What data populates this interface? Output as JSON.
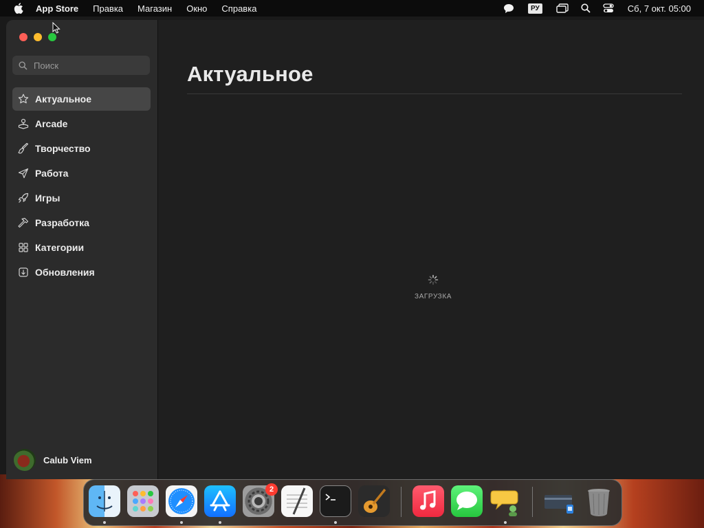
{
  "menubar": {
    "app_name": "App Store",
    "menus": [
      "Правка",
      "Магазин",
      "Окно",
      "Справка"
    ],
    "input_language": "РУ",
    "datetime": "Сб, 7 окт.  05:00"
  },
  "sidebar": {
    "search_placeholder": "Поиск",
    "items": [
      {
        "label": "Актуальное",
        "icon": "star-icon",
        "active": true
      },
      {
        "label": "Arcade",
        "icon": "joystick-icon"
      },
      {
        "label": "Творчество",
        "icon": "brush-icon"
      },
      {
        "label": "Работа",
        "icon": "paper-plane-icon"
      },
      {
        "label": "Игры",
        "icon": "rocket-icon"
      },
      {
        "label": "Разработка",
        "icon": "hammer-icon"
      },
      {
        "label": "Категории",
        "icon": "grid-icon"
      },
      {
        "label": "Обновления",
        "icon": "download-icon"
      }
    ],
    "user_name": "Calub Viem"
  },
  "main": {
    "title": "Актуальное",
    "loading_text": "ЗАГРУЗКА"
  },
  "dock": {
    "apps": [
      "Finder",
      "Launchpad",
      "Safari",
      "App Store",
      "System Settings",
      "TextEdit",
      "Terminal",
      "GarageBand",
      "Music",
      "Messages",
      "Chat",
      "Downloads",
      "Trash"
    ],
    "settings_badge": "2"
  },
  "colors": {
    "menubar_bg": "#0c0c0c",
    "sidebar_bg": "#2b2b2b",
    "content_bg": "#1f1f1f",
    "active_item_bg": "#464646"
  }
}
